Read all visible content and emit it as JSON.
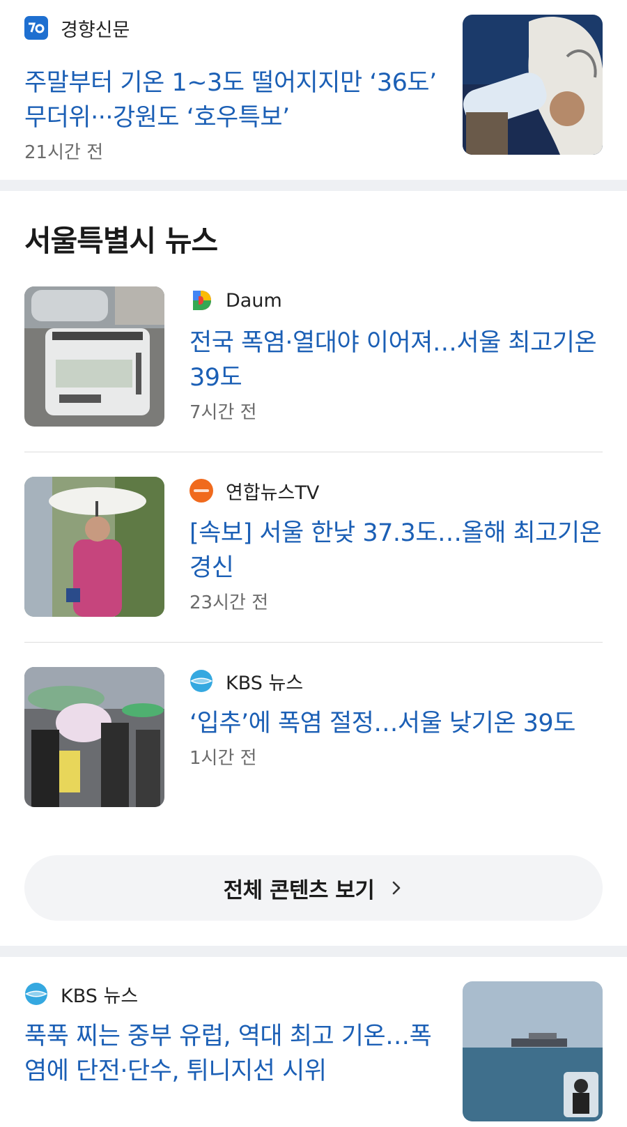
{
  "top_article": {
    "source": "경향신문",
    "source_icon": "kyunghyang-logo-icon",
    "headline": "주말부터 기온 1~3도 떨어지지만 ‘36도’ 무더위···강원도 ‘호우특보’",
    "time": "21시간 전"
  },
  "section": {
    "title": "서울특별시 뉴스",
    "articles": [
      {
        "source": "Daum",
        "source_icon": "daum-logo-icon",
        "headline": "전국 폭염·열대야 이어져…서울 최고기온 39도",
        "time": "7시간 전"
      },
      {
        "source": "연합뉴스TV",
        "source_icon": "yonhapnewstv-logo-icon",
        "headline": "[속보] 서울 한낮 37.3도…올해 최고기온 경신",
        "time": "23시간 전"
      },
      {
        "source": "KBS 뉴스",
        "source_icon": "kbs-logo-icon",
        "headline": "‘입추’에 폭염 절정…서울 낮기온 39도",
        "time": "1시간 전"
      }
    ],
    "more_label": "전체 콘텐츠 보기"
  },
  "bottom_article": {
    "source": "KBS 뉴스",
    "source_icon": "kbs-logo-icon",
    "headline": "푹푹 찌는 중부 유럽, 역대 최고 기온…폭염에 단전·단수, 튀니지선 시위"
  },
  "colors": {
    "headline": "#1b5fb5",
    "divider": "#eef0f3",
    "button_bg": "#f3f4f6"
  }
}
